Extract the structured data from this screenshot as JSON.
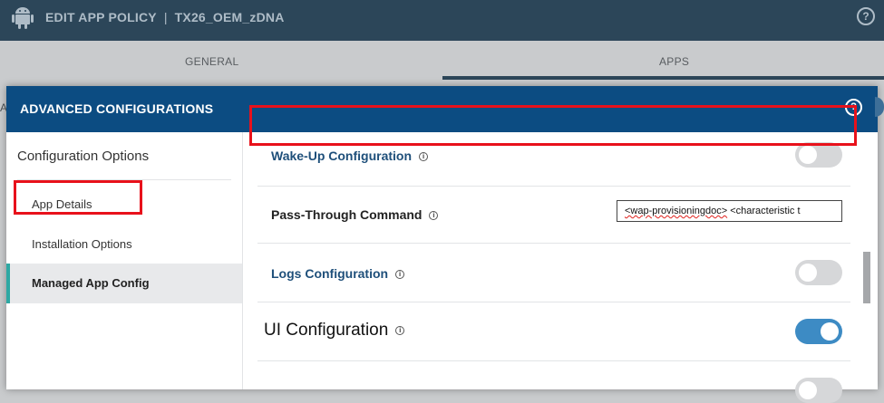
{
  "background": {
    "title": "EDIT APP POLICY",
    "separator": "|",
    "policy_name": "TX26_OEM_zDNA",
    "help_glyph": "?",
    "tabs": [
      {
        "label": "GENERAL",
        "active": false
      },
      {
        "label": "APPS",
        "active": true
      }
    ],
    "left_sliver": "A"
  },
  "modal": {
    "title": "ADVANCED CONFIGURATIONS",
    "help_glyph": "?"
  },
  "sidebar": {
    "heading": "Configuration Options",
    "items": [
      {
        "label": "App Details",
        "active": false
      },
      {
        "label": "Installation Options",
        "active": false
      },
      {
        "label": "Managed App Config",
        "active": true
      }
    ]
  },
  "rows": {
    "wakeup": {
      "label": "Wake-Up Configuration",
      "enabled": false
    },
    "passthrough": {
      "label": "Pass-Through Command",
      "value_part1": "<wap-provisioningdoc>",
      "value_part2": " <characteristic ",
      "value_part3": "t"
    },
    "logs": {
      "label": "Logs Configuration",
      "enabled": false
    },
    "ui": {
      "label": "UI Configuration",
      "enabled": true
    },
    "next": {
      "enabled": false
    }
  },
  "icons": {
    "info": "i"
  },
  "colors": {
    "header_bg": "#2c4659",
    "modal_header_bg": "#0c4c82",
    "accent_teal": "#2da8a3",
    "toggle_on": "#3d8bc4",
    "highlight_red": "#e8111b"
  }
}
